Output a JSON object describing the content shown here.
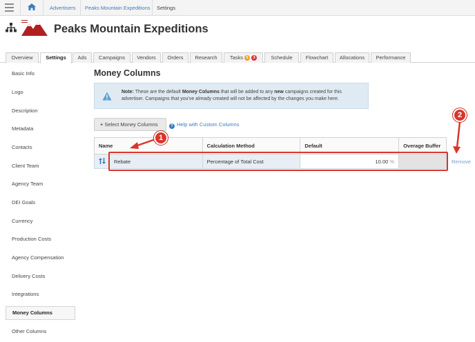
{
  "breadcrumb": {
    "home": "home-icon",
    "items": [
      "Advertisers",
      "Peaks Mountain Expeditions",
      "Settings"
    ]
  },
  "header": {
    "title": "Peaks Mountain Expeditions"
  },
  "tabs": [
    {
      "label": "Overview"
    },
    {
      "label": "Settings",
      "active": true
    },
    {
      "label": "Ads"
    },
    {
      "label": "Campaigns"
    },
    {
      "label": "Vendors"
    },
    {
      "label": "Orders"
    },
    {
      "label": "Research"
    },
    {
      "label": "Tasks",
      "badges": [
        "5",
        "3"
      ]
    },
    {
      "label": "Schedule"
    },
    {
      "label": "Flowchart"
    },
    {
      "label": "Allocations"
    },
    {
      "label": "Performance"
    }
  ],
  "sidebar": {
    "items": [
      "Basic Info",
      "Logo",
      "Description",
      "Metadata",
      "Contacts",
      "Client Team",
      "Agency Team",
      "DEI Goals",
      "Currency",
      "Production Costs",
      "Agency Compensation",
      "Delivery Costs",
      "Integrations",
      "Money Columns",
      "Other Columns"
    ],
    "active": "Money Columns"
  },
  "main": {
    "title": "Money Columns",
    "note": {
      "prefix": "Note:",
      "text1": " These are the default ",
      "bold1": "Money Columns",
      "text2": " that will be added to any ",
      "bold2": "new",
      "text3": " campaigns created for this advertiser. Campaigns that you've already created will not be affected by the changes you make here."
    },
    "select_button": "Select Money Columns",
    "help_link": "Help with Custom Columns",
    "table": {
      "headers": [
        "Name",
        "Calculation Method",
        "Default",
        "Overage Buffer"
      ],
      "rows": [
        {
          "name": "Rebate",
          "method": "Percentage of Total Cost",
          "default_value": "10.00",
          "unit": "%",
          "overage": ""
        }
      ]
    },
    "remove_link": "Remove"
  },
  "annotations": {
    "callout1": "1",
    "callout2": "2",
    "color": "#d9352b"
  },
  "colors": {
    "link": "#3a7cc2",
    "note_bg": "#dfeaf3",
    "accent_red": "#d9352b",
    "badge_orange": "#f0a020"
  }
}
